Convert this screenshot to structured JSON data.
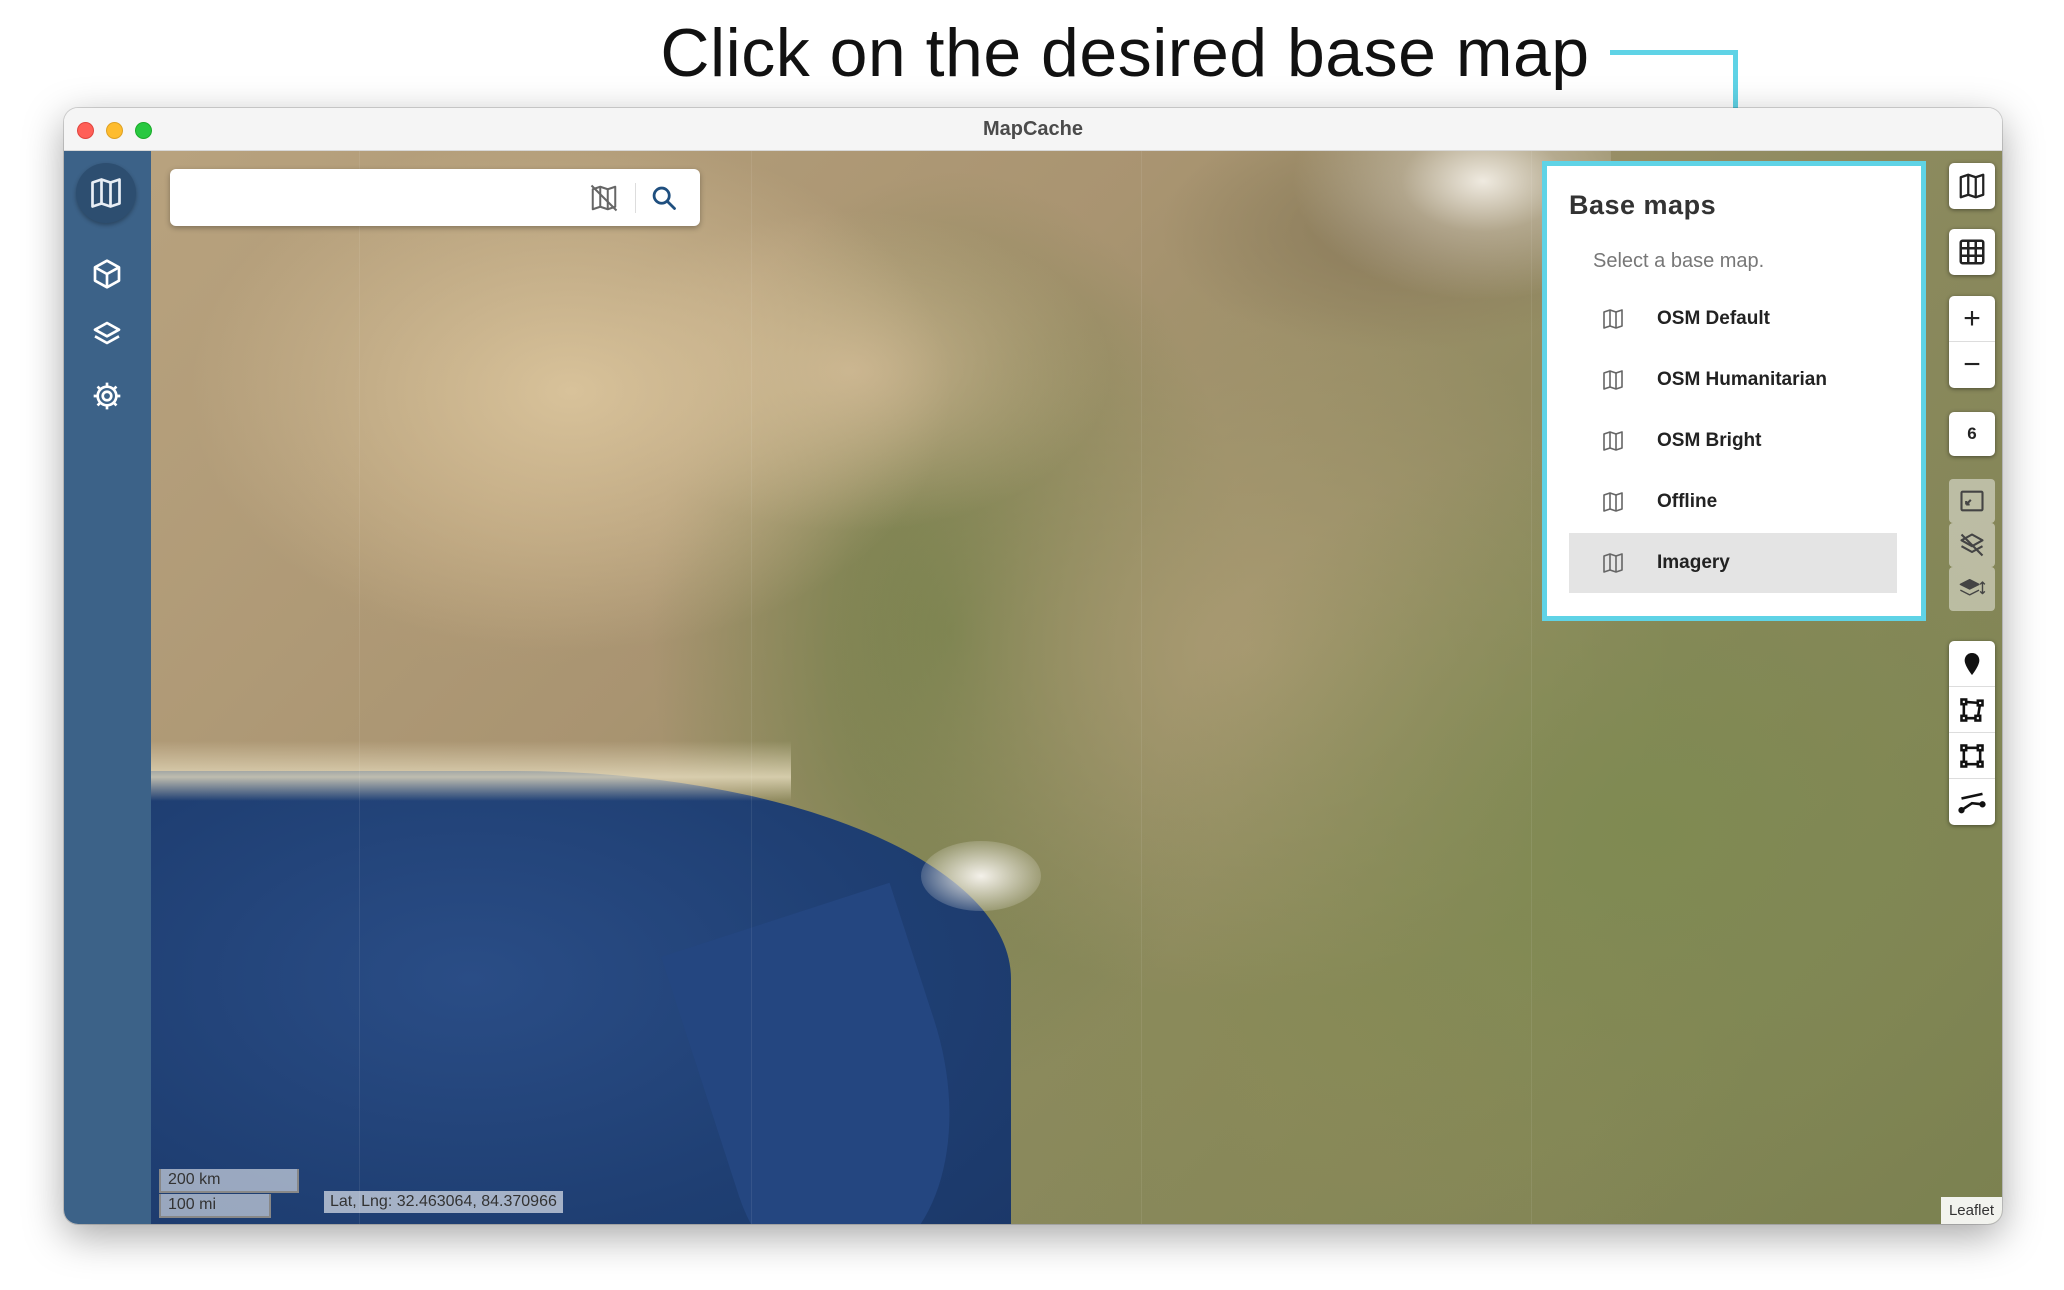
{
  "annotation": {
    "text": "Click on the desired base map",
    "accent_color": "#5fd3e6"
  },
  "window": {
    "title": "MapCache",
    "traffic_lights": [
      "close",
      "minimize",
      "zoom"
    ]
  },
  "sidebar": {
    "background": "#3c6288",
    "items": [
      {
        "name": "logo",
        "icon": "map-icon"
      },
      {
        "name": "projects",
        "icon": "cube-icon"
      },
      {
        "name": "layers",
        "icon": "layers-icon"
      },
      {
        "name": "settings",
        "icon": "gear-icon"
      }
    ]
  },
  "search": {
    "value": "",
    "placeholder": "",
    "icons": [
      "map-off-icon",
      "search-icon"
    ]
  },
  "base_maps": {
    "title": "Base maps",
    "subtitle": "Select a base map.",
    "items": [
      {
        "label": "OSM Default",
        "selected": false
      },
      {
        "label": "OSM Humanitarian",
        "selected": false
      },
      {
        "label": "OSM Bright",
        "selected": false
      },
      {
        "label": "Offline",
        "selected": false
      },
      {
        "label": "Imagery",
        "selected": true
      }
    ]
  },
  "map_controls": {
    "zoom_in": "+",
    "zoom_out": "−",
    "zoom_level": "6",
    "tools": [
      "marker-icon",
      "polygon-icon",
      "rectangle-icon",
      "polyline-icon"
    ]
  },
  "map": {
    "scale_km": "200 km",
    "scale_mi": "100 mi",
    "latlng": "Lat, Lng: 32.463064, 84.370966",
    "attribution": "Leaflet"
  }
}
